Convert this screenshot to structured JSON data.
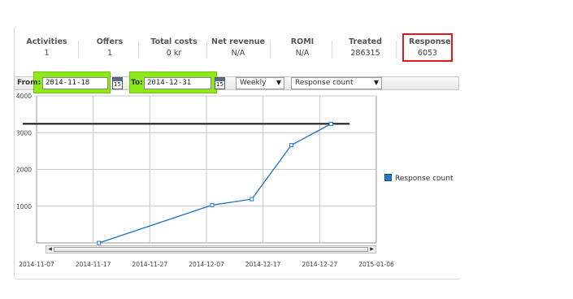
{
  "kpis": [
    {
      "label": "Activities",
      "value": "1"
    },
    {
      "label": "Offers",
      "value": "1"
    },
    {
      "label": "Total costs",
      "value": "0 kr"
    },
    {
      "label": "Net revenue",
      "value": "N/A"
    },
    {
      "label": "ROMI",
      "value": "N/A"
    },
    {
      "label": "Treated",
      "value": "286315"
    },
    {
      "label": "Response",
      "value": "6053"
    }
  ],
  "toolbar": {
    "from_label": "From:",
    "from_value": "2014-11-18",
    "to_label": "To:",
    "to_value": "2014-12-31",
    "calendar_day": "15",
    "interval": "Weekly",
    "metric": "Response count"
  },
  "colors": {
    "highlight_green": "#8ee81a",
    "highlight_red": "#e0191f",
    "series_blue": "#2a76c9"
  },
  "chart_data": {
    "type": "line",
    "series": [
      {
        "name": "Response count",
        "x": [
          "2014-11-18",
          "2014-12-08",
          "2014-12-15",
          "2014-12-22",
          "2014-12-29"
        ],
        "values": [
          0,
          1030,
          1190,
          2660,
          3240
        ]
      }
    ],
    "reference_line": 3240,
    "y_ticks": [
      "4000",
      "3000",
      "2000",
      "1000"
    ],
    "x_ticks": [
      "2014-11-07",
      "2014-11-17",
      "2014-11-27",
      "2014-12-07",
      "2014-12-17",
      "2014-12-27",
      "2015-01-06"
    ],
    "xlim": [
      "2014-11-07",
      "2015-01-06"
    ],
    "ylim": [
      0,
      4000
    ],
    "grid": true,
    "legend": "right"
  }
}
